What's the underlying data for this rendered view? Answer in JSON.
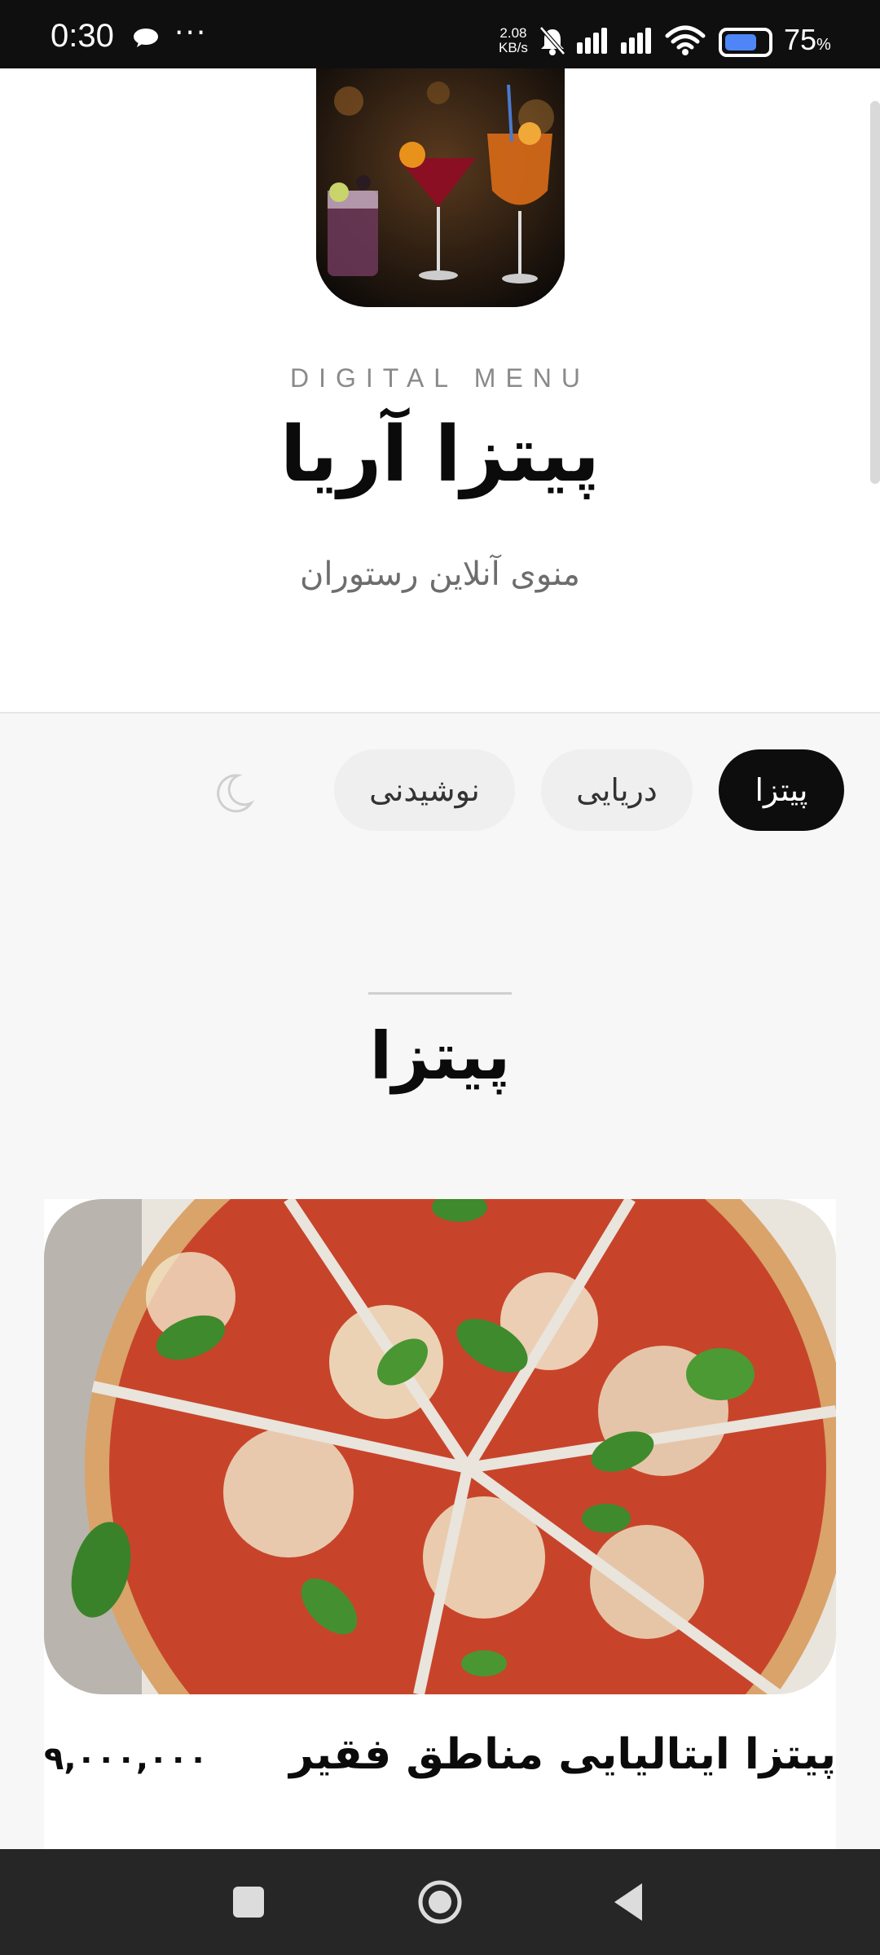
{
  "status_bar": {
    "time": "0:30",
    "dots": "···",
    "speed_value": "2.08",
    "speed_unit": "KB/s",
    "battery_percent": "75",
    "battery_unit": "%",
    "battery_level": 0.75,
    "icons": [
      "chat-icon",
      "mute-icon",
      "signal-icon",
      "signal-icon",
      "wifi-icon",
      "battery-icon"
    ]
  },
  "header": {
    "eyebrow": "DIGITAL MENU",
    "restaurant_name": "پیتزا آریا",
    "subtitle": "منوی آنلاین رستوران"
  },
  "tabs": [
    {
      "label": "پیتزا",
      "active": true
    },
    {
      "label": "دریایی",
      "active": false
    },
    {
      "label": "نوشیدنی",
      "active": false
    }
  ],
  "theme_toggle_icon": "moon-icon",
  "section": {
    "title": "پیتزا"
  },
  "items": [
    {
      "name": "پیتزا ایتالیایی مناطق فقیر",
      "price": "۹,۰۰۰,۰۰۰"
    }
  ],
  "nav_bar": {
    "icons": [
      "recents-icon",
      "home-icon",
      "back-icon"
    ]
  },
  "colors": {
    "active_tab": "#0d0d0d",
    "inactive_tab": "#efefef",
    "status_bar": "#0f0f10",
    "nav_bar": "#262626"
  }
}
